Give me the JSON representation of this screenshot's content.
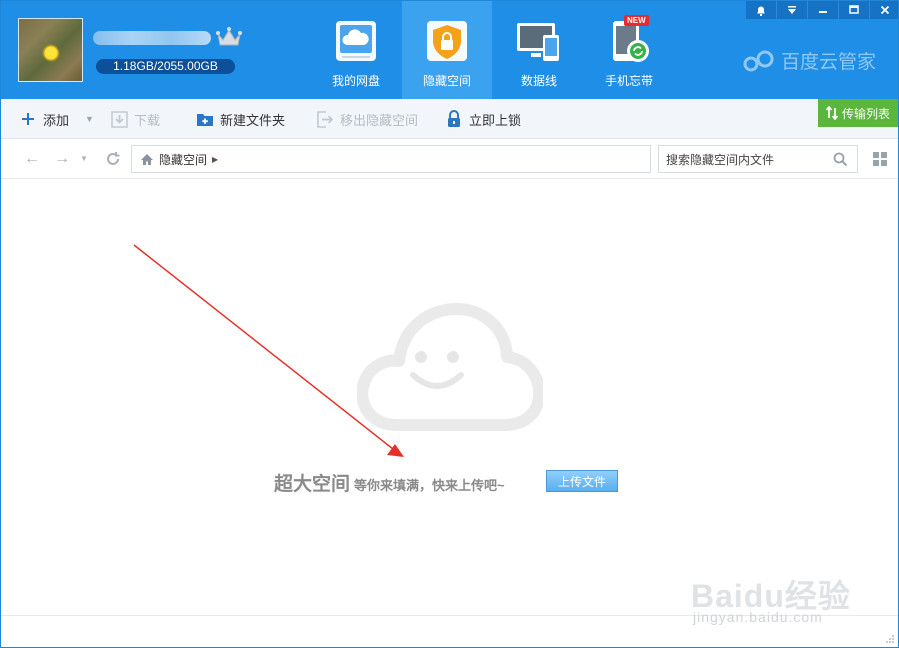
{
  "header": {
    "quota": "1.18GB/2055.00GB",
    "brand": "百度云管家",
    "tabs": [
      {
        "label": "我的网盘",
        "icon": "cloud-drive-icon"
      },
      {
        "label": "隐藏空间",
        "icon": "lock-shield-icon"
      },
      {
        "label": "数据线",
        "icon": "devices-icon"
      },
      {
        "label": "手机忘带",
        "icon": "phone-sync-icon"
      }
    ],
    "new_badge": "NEW"
  },
  "toolbar": {
    "add": "添加",
    "download": "下载",
    "new_folder": "新建文件夹",
    "move_out": "移出隐藏空间",
    "lock": "立即上锁",
    "transfer": "传输列表"
  },
  "address": {
    "path": "隐藏空间",
    "search_placeholder": "搜索隐藏空间内文件"
  },
  "empty": {
    "title": "超大空间",
    "subtitle": "等你来填满，快来上传吧~",
    "upload_button": "上传文件"
  },
  "watermark": {
    "text": "Baidu经验",
    "sub": "jingyan.baidu.com"
  },
  "colors": {
    "header": "#1e8ee6",
    "active_tab": "#3aa2ef",
    "transfer": "#5bb73c",
    "arrow": "#e8302a"
  }
}
